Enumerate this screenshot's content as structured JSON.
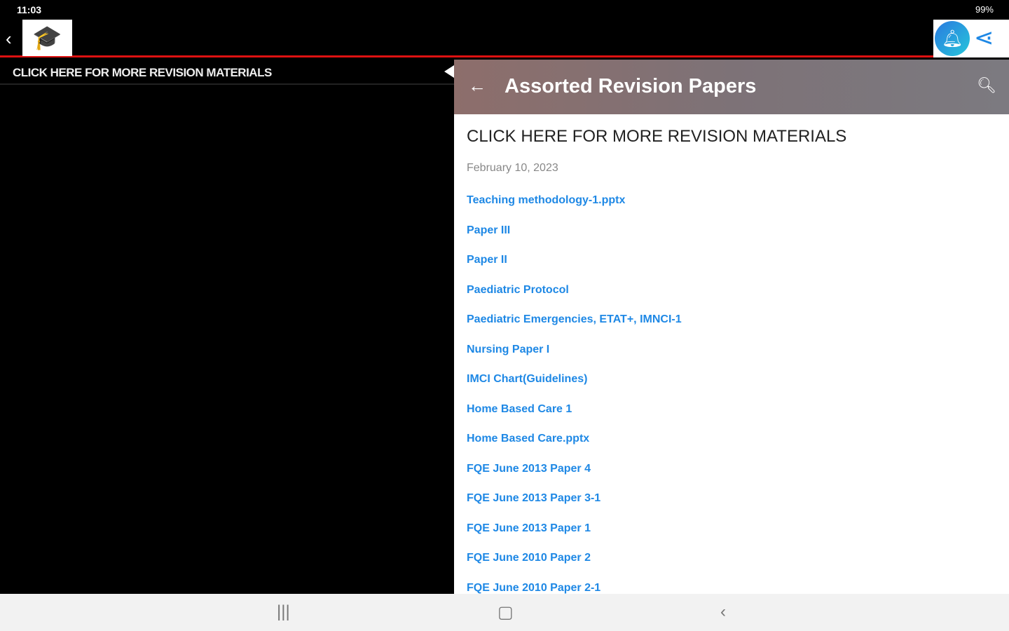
{
  "status": {
    "time": "11:03",
    "battery": "99%"
  },
  "appbar": {
    "logo": "graduation-cap-logo"
  },
  "left": {
    "header": "CLICK HERE FOR MORE REVISION MATERIALS"
  },
  "right": {
    "title": "Assorted Revision Papers",
    "post_title": "CLICK HERE FOR MORE REVISION MATERIALS",
    "date": "February 10, 2023",
    "links": [
      "Teaching methodology-1.pptx",
      "Paper III",
      "Paper II",
      "Paediatric Protocol",
      "Paediatric Emergencies, ETAT+, IMNCI-1",
      "Nursing Paper I",
      "IMCI Chart(Guidelines)",
      "Home Based Care 1",
      "Home Based Care.pptx",
      "FQE June 2013 Paper 4",
      "FQE June 2013 Paper 3-1",
      "FQE June 2013 Paper 1",
      "FQE June 2010 Paper 2",
      "FQE June 2010 Paper 2-1"
    ]
  },
  "colors": {
    "accent": "#1e88e5",
    "divider": "#dd1111"
  }
}
